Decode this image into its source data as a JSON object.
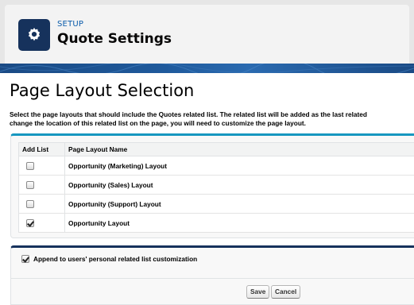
{
  "header": {
    "eyebrow": "SETUP",
    "title": "Quote Settings"
  },
  "page": {
    "title": "Page Layout Selection",
    "description_line1": "Select the page layouts that should include the Quotes related list. The related list will be added as the last related",
    "description_line2": "change the location of this related list on the page, you will need to customize the page layout."
  },
  "table": {
    "headers": [
      "Add List",
      "Page Layout Name"
    ],
    "rows": [
      {
        "name": "Opportunity (Marketing) Layout",
        "checked": false
      },
      {
        "name": "Opportunity (Sales) Layout",
        "checked": false
      },
      {
        "name": "Opportunity (Support) Layout",
        "checked": false
      },
      {
        "name": "Opportunity Layout",
        "checked": true
      }
    ]
  },
  "append": {
    "label": "Append to users' personal related list customization",
    "checked": true
  },
  "buttons": {
    "save": "Save",
    "cancel": "Cancel"
  },
  "colors": {
    "accent": "#1797c0",
    "brand_dark": "#16325c",
    "link": "#0b5cab"
  }
}
